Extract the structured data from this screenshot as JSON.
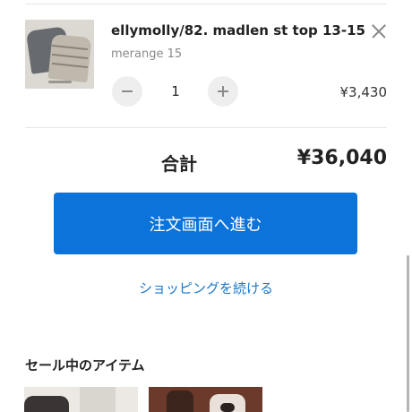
{
  "cart": {
    "items": [
      {
        "title": "ellymolly/82. madlen st top 13-15",
        "variant": "merange 15",
        "quantity": "1",
        "price": "¥3,430",
        "image_icon": "product-thumbnail"
      }
    ],
    "total_label": "合計",
    "total_value": "¥36,040"
  },
  "actions": {
    "checkout_label": "注文画面へ進む",
    "continue_label": "ショッピングを続ける"
  },
  "sale": {
    "heading": "セール中のアイテム"
  },
  "colors": {
    "primary": "#0b73d9",
    "link": "#1a77c9"
  }
}
